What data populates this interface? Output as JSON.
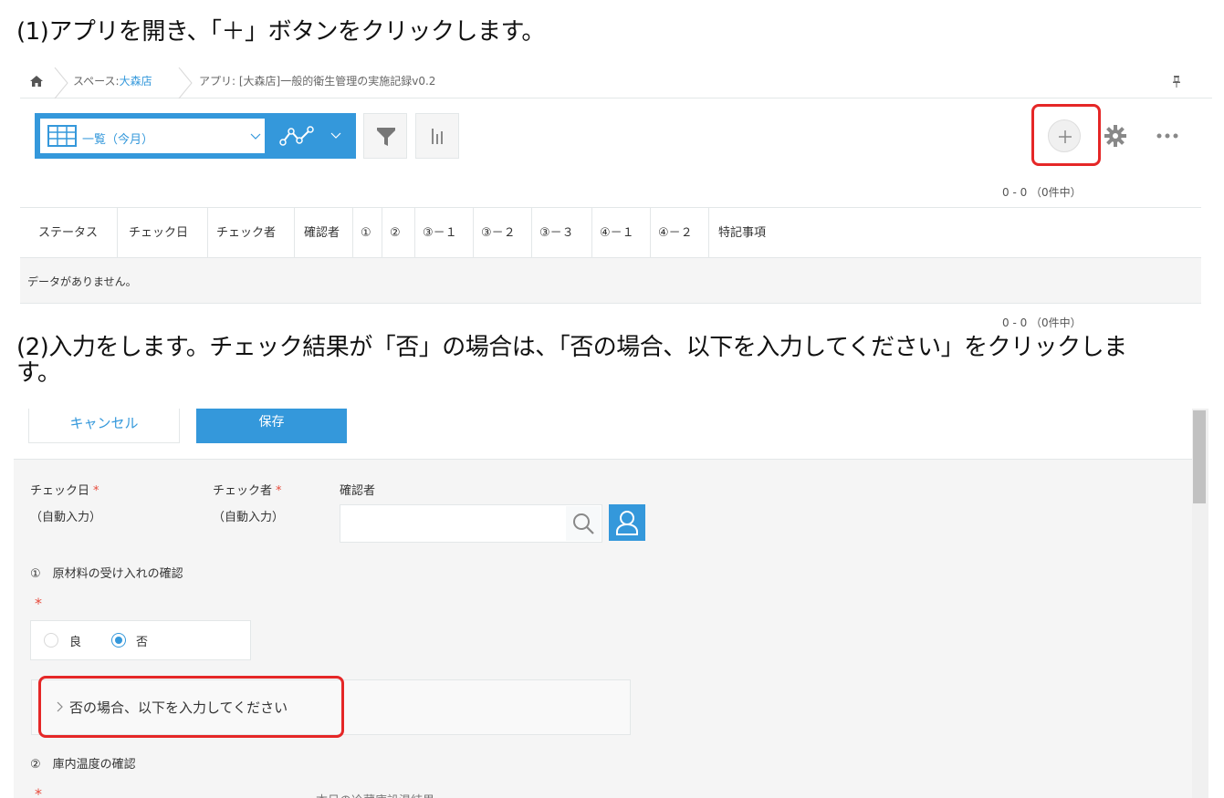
{
  "steps": {
    "step1": "(1)アプリを開き、「＋」ボタンをクリックします。",
    "step2_line1": "(2)入力をします。チェック結果が「否」の場合は、「否の場合、以下を入力してください」をクリックしま",
    "step2_line2": "す。"
  },
  "breadcrumb": {
    "home_icon": "home-icon",
    "space_prefix": "スペース:",
    "space_name": "大森店",
    "app": "アプリ: [大森店]一般的衛生管理の実施記録v0.2",
    "pin_icon": "pin-icon"
  },
  "toolbar": {
    "view_label": "一覧（今月）",
    "view_icon": "table-view-icon",
    "graph_icon": "graph-icon",
    "filter_icon": "filter-icon",
    "chart_icon": "bar-chart-icon",
    "add_icon": "plus-icon",
    "settings_icon": "gear-icon",
    "more_icon": "more-icon"
  },
  "list": {
    "count_top": "0 - 0 （0件中）",
    "count_bottom": "0 - 0 （0件中）",
    "columns": [
      "ステータス",
      "チェック日",
      "チェック者",
      "確認者",
      "①",
      "②",
      "③－１",
      "③－２",
      "③－３",
      "④－１",
      "④－２",
      "特記事項"
    ],
    "empty_message": "データがありません。"
  },
  "form": {
    "cancel_label": "キャンセル",
    "save_label": "保存",
    "check_date_label": "チェック日",
    "check_date_value": "（自動入力）",
    "checker_label": "チェック者",
    "checker_value": "（自動入力）",
    "confirmer_label": "確認者",
    "required_mark": "*",
    "section1_label": "①　原材料の受け入れの確認",
    "radio_good": "良",
    "radio_bad": "否",
    "group_label": "否の場合、以下を入力してください",
    "section2_label": "②　庫内温度の確認",
    "cut_text": "本日の冷蔵庫設温結果"
  },
  "colors": {
    "accent": "#3498db",
    "highlight": "#e52727",
    "required": "#e74b3c"
  }
}
